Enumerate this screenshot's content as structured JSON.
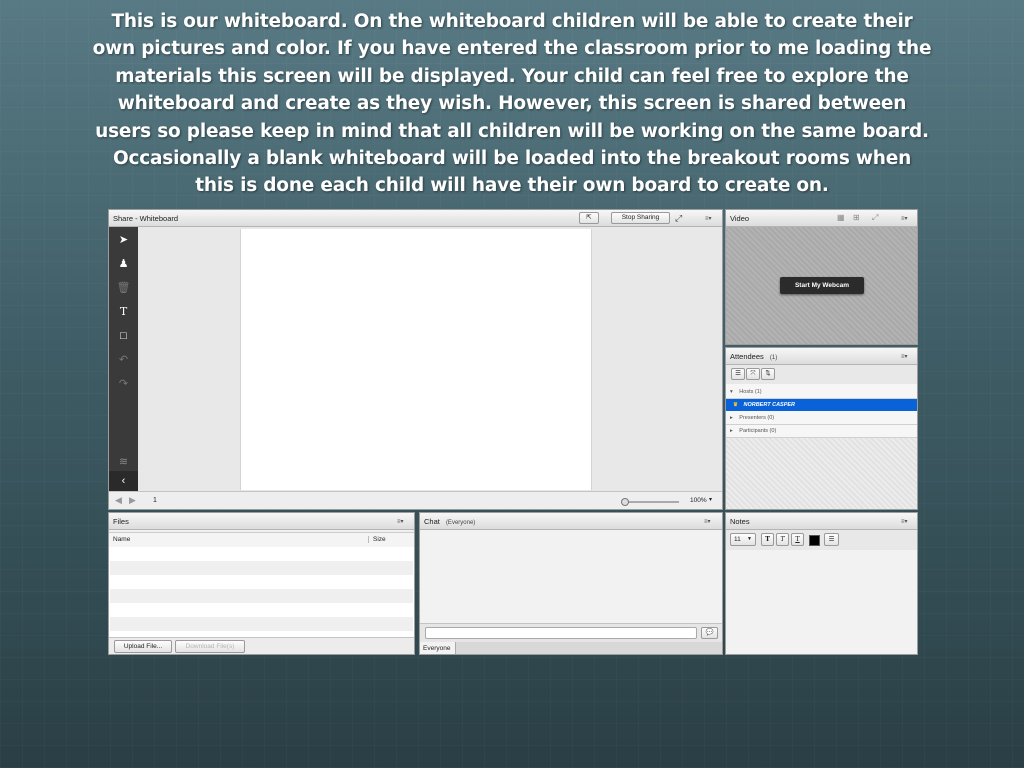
{
  "caption": "This is our whiteboard.  On the whiteboard children will be able to create their own pictures and color.  If you have entered the classroom prior to me loading the materials this screen will be displayed.  Your child can feel free to explore the whiteboard and create as they wish.  However, this screen is shared between users so please keep in mind that all children will be working on the same board. Occasionally a blank whiteboard will be loaded into the breakout rooms when this is done each child will have their own board to create on.",
  "whiteboard": {
    "title": "Share - Whiteboard",
    "stop_sharing": "Stop Sharing",
    "page_number": "1",
    "zoom": "100%",
    "tools": [
      "select-icon",
      "marker-icon",
      "trash-icon",
      "text-icon",
      "rectangle-icon",
      "undo-icon",
      "redo-icon",
      "layers-icon",
      "collapse-icon"
    ]
  },
  "video": {
    "title": "Video",
    "webcam_button": "Start My Webcam"
  },
  "attendees": {
    "title": "Attendees",
    "count": "(1)",
    "hosts_label": "Hosts (1)",
    "host_name": "NORBERT CASPER",
    "presenters_label": "Presenters (0)",
    "participants_label": "Participants (0)"
  },
  "files": {
    "title": "Files",
    "col_name": "Name",
    "col_size": "Size",
    "upload_button": "Upload File...",
    "download_button": "Download File(s)"
  },
  "chat": {
    "title": "Chat",
    "scope": "(Everyone)",
    "tab_everyone": "Everyone"
  },
  "notes": {
    "title": "Notes",
    "font_size": "11"
  },
  "colors": {
    "selection": "#0a62d8",
    "toolbar_dark": "#3a3a3a"
  }
}
